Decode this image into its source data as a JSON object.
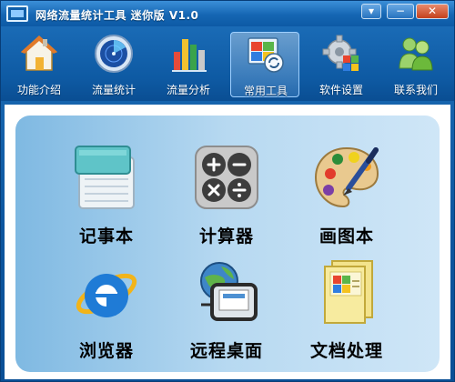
{
  "window": {
    "title": "网络流量统计工具 迷你版 V1.0",
    "menu_glyph": "▾",
    "min_glyph": "−",
    "close_glyph": "✕"
  },
  "toolbar": {
    "items": [
      {
        "label": "功能介绍",
        "icon": "home-icon"
      },
      {
        "label": "流量统计",
        "icon": "radar-icon"
      },
      {
        "label": "流量分析",
        "icon": "bar-chart-icon"
      },
      {
        "label": "常用工具",
        "icon": "tools-window-icon",
        "active": true
      },
      {
        "label": "软件设置",
        "icon": "gear-icon"
      },
      {
        "label": "联系我们",
        "icon": "users-icon"
      }
    ]
  },
  "tools": [
    {
      "label": "记事本",
      "icon": "notepad-icon"
    },
    {
      "label": "计算器",
      "icon": "calculator-icon"
    },
    {
      "label": "画图本",
      "icon": "paint-palette-icon"
    },
    {
      "label": "浏览器",
      "icon": "browser-ie-icon"
    },
    {
      "label": "远程桌面",
      "icon": "remote-desktop-icon"
    },
    {
      "label": "文档处理",
      "icon": "office-document-icon"
    }
  ],
  "colors": {
    "titlebar": "#1566b3",
    "panel_background": "#b7d9f1",
    "close_button": "#c4411d"
  }
}
